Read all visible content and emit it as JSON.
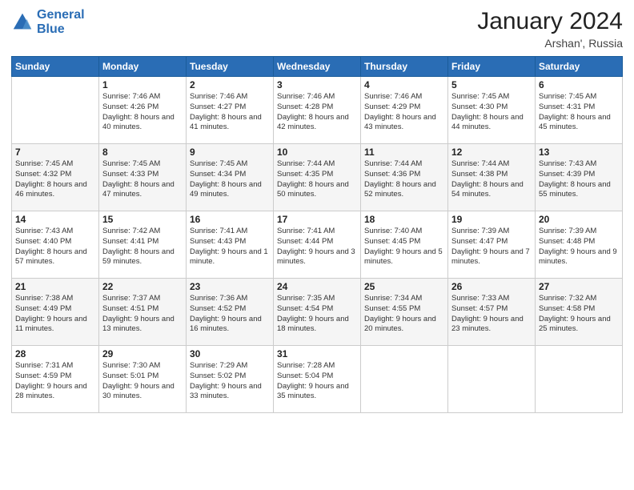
{
  "header": {
    "logo_line1": "General",
    "logo_line2": "Blue",
    "month": "January 2024",
    "location": "Arshan', Russia"
  },
  "days_of_week": [
    "Sunday",
    "Monday",
    "Tuesday",
    "Wednesday",
    "Thursday",
    "Friday",
    "Saturday"
  ],
  "weeks": [
    [
      {
        "num": "",
        "sunrise": "",
        "sunset": "",
        "daylight": ""
      },
      {
        "num": "1",
        "sunrise": "Sunrise: 7:46 AM",
        "sunset": "Sunset: 4:26 PM",
        "daylight": "Daylight: 8 hours and 40 minutes."
      },
      {
        "num": "2",
        "sunrise": "Sunrise: 7:46 AM",
        "sunset": "Sunset: 4:27 PM",
        "daylight": "Daylight: 8 hours and 41 minutes."
      },
      {
        "num": "3",
        "sunrise": "Sunrise: 7:46 AM",
        "sunset": "Sunset: 4:28 PM",
        "daylight": "Daylight: 8 hours and 42 minutes."
      },
      {
        "num": "4",
        "sunrise": "Sunrise: 7:46 AM",
        "sunset": "Sunset: 4:29 PM",
        "daylight": "Daylight: 8 hours and 43 minutes."
      },
      {
        "num": "5",
        "sunrise": "Sunrise: 7:45 AM",
        "sunset": "Sunset: 4:30 PM",
        "daylight": "Daylight: 8 hours and 44 minutes."
      },
      {
        "num": "6",
        "sunrise": "Sunrise: 7:45 AM",
        "sunset": "Sunset: 4:31 PM",
        "daylight": "Daylight: 8 hours and 45 minutes."
      }
    ],
    [
      {
        "num": "7",
        "sunrise": "Sunrise: 7:45 AM",
        "sunset": "Sunset: 4:32 PM",
        "daylight": "Daylight: 8 hours and 46 minutes."
      },
      {
        "num": "8",
        "sunrise": "Sunrise: 7:45 AM",
        "sunset": "Sunset: 4:33 PM",
        "daylight": "Daylight: 8 hours and 47 minutes."
      },
      {
        "num": "9",
        "sunrise": "Sunrise: 7:45 AM",
        "sunset": "Sunset: 4:34 PM",
        "daylight": "Daylight: 8 hours and 49 minutes."
      },
      {
        "num": "10",
        "sunrise": "Sunrise: 7:44 AM",
        "sunset": "Sunset: 4:35 PM",
        "daylight": "Daylight: 8 hours and 50 minutes."
      },
      {
        "num": "11",
        "sunrise": "Sunrise: 7:44 AM",
        "sunset": "Sunset: 4:36 PM",
        "daylight": "Daylight: 8 hours and 52 minutes."
      },
      {
        "num": "12",
        "sunrise": "Sunrise: 7:44 AM",
        "sunset": "Sunset: 4:38 PM",
        "daylight": "Daylight: 8 hours and 54 minutes."
      },
      {
        "num": "13",
        "sunrise": "Sunrise: 7:43 AM",
        "sunset": "Sunset: 4:39 PM",
        "daylight": "Daylight: 8 hours and 55 minutes."
      }
    ],
    [
      {
        "num": "14",
        "sunrise": "Sunrise: 7:43 AM",
        "sunset": "Sunset: 4:40 PM",
        "daylight": "Daylight: 8 hours and 57 minutes."
      },
      {
        "num": "15",
        "sunrise": "Sunrise: 7:42 AM",
        "sunset": "Sunset: 4:41 PM",
        "daylight": "Daylight: 8 hours and 59 minutes."
      },
      {
        "num": "16",
        "sunrise": "Sunrise: 7:41 AM",
        "sunset": "Sunset: 4:43 PM",
        "daylight": "Daylight: 9 hours and 1 minute."
      },
      {
        "num": "17",
        "sunrise": "Sunrise: 7:41 AM",
        "sunset": "Sunset: 4:44 PM",
        "daylight": "Daylight: 9 hours and 3 minutes."
      },
      {
        "num": "18",
        "sunrise": "Sunrise: 7:40 AM",
        "sunset": "Sunset: 4:45 PM",
        "daylight": "Daylight: 9 hours and 5 minutes."
      },
      {
        "num": "19",
        "sunrise": "Sunrise: 7:39 AM",
        "sunset": "Sunset: 4:47 PM",
        "daylight": "Daylight: 9 hours and 7 minutes."
      },
      {
        "num": "20",
        "sunrise": "Sunrise: 7:39 AM",
        "sunset": "Sunset: 4:48 PM",
        "daylight": "Daylight: 9 hours and 9 minutes."
      }
    ],
    [
      {
        "num": "21",
        "sunrise": "Sunrise: 7:38 AM",
        "sunset": "Sunset: 4:49 PM",
        "daylight": "Daylight: 9 hours and 11 minutes."
      },
      {
        "num": "22",
        "sunrise": "Sunrise: 7:37 AM",
        "sunset": "Sunset: 4:51 PM",
        "daylight": "Daylight: 9 hours and 13 minutes."
      },
      {
        "num": "23",
        "sunrise": "Sunrise: 7:36 AM",
        "sunset": "Sunset: 4:52 PM",
        "daylight": "Daylight: 9 hours and 16 minutes."
      },
      {
        "num": "24",
        "sunrise": "Sunrise: 7:35 AM",
        "sunset": "Sunset: 4:54 PM",
        "daylight": "Daylight: 9 hours and 18 minutes."
      },
      {
        "num": "25",
        "sunrise": "Sunrise: 7:34 AM",
        "sunset": "Sunset: 4:55 PM",
        "daylight": "Daylight: 9 hours and 20 minutes."
      },
      {
        "num": "26",
        "sunrise": "Sunrise: 7:33 AM",
        "sunset": "Sunset: 4:57 PM",
        "daylight": "Daylight: 9 hours and 23 minutes."
      },
      {
        "num": "27",
        "sunrise": "Sunrise: 7:32 AM",
        "sunset": "Sunset: 4:58 PM",
        "daylight": "Daylight: 9 hours and 25 minutes."
      }
    ],
    [
      {
        "num": "28",
        "sunrise": "Sunrise: 7:31 AM",
        "sunset": "Sunset: 4:59 PM",
        "daylight": "Daylight: 9 hours and 28 minutes."
      },
      {
        "num": "29",
        "sunrise": "Sunrise: 7:30 AM",
        "sunset": "Sunset: 5:01 PM",
        "daylight": "Daylight: 9 hours and 30 minutes."
      },
      {
        "num": "30",
        "sunrise": "Sunrise: 7:29 AM",
        "sunset": "Sunset: 5:02 PM",
        "daylight": "Daylight: 9 hours and 33 minutes."
      },
      {
        "num": "31",
        "sunrise": "Sunrise: 7:28 AM",
        "sunset": "Sunset: 5:04 PM",
        "daylight": "Daylight: 9 hours and 35 minutes."
      },
      {
        "num": "",
        "sunrise": "",
        "sunset": "",
        "daylight": ""
      },
      {
        "num": "",
        "sunrise": "",
        "sunset": "",
        "daylight": ""
      },
      {
        "num": "",
        "sunrise": "",
        "sunset": "",
        "daylight": ""
      }
    ]
  ]
}
